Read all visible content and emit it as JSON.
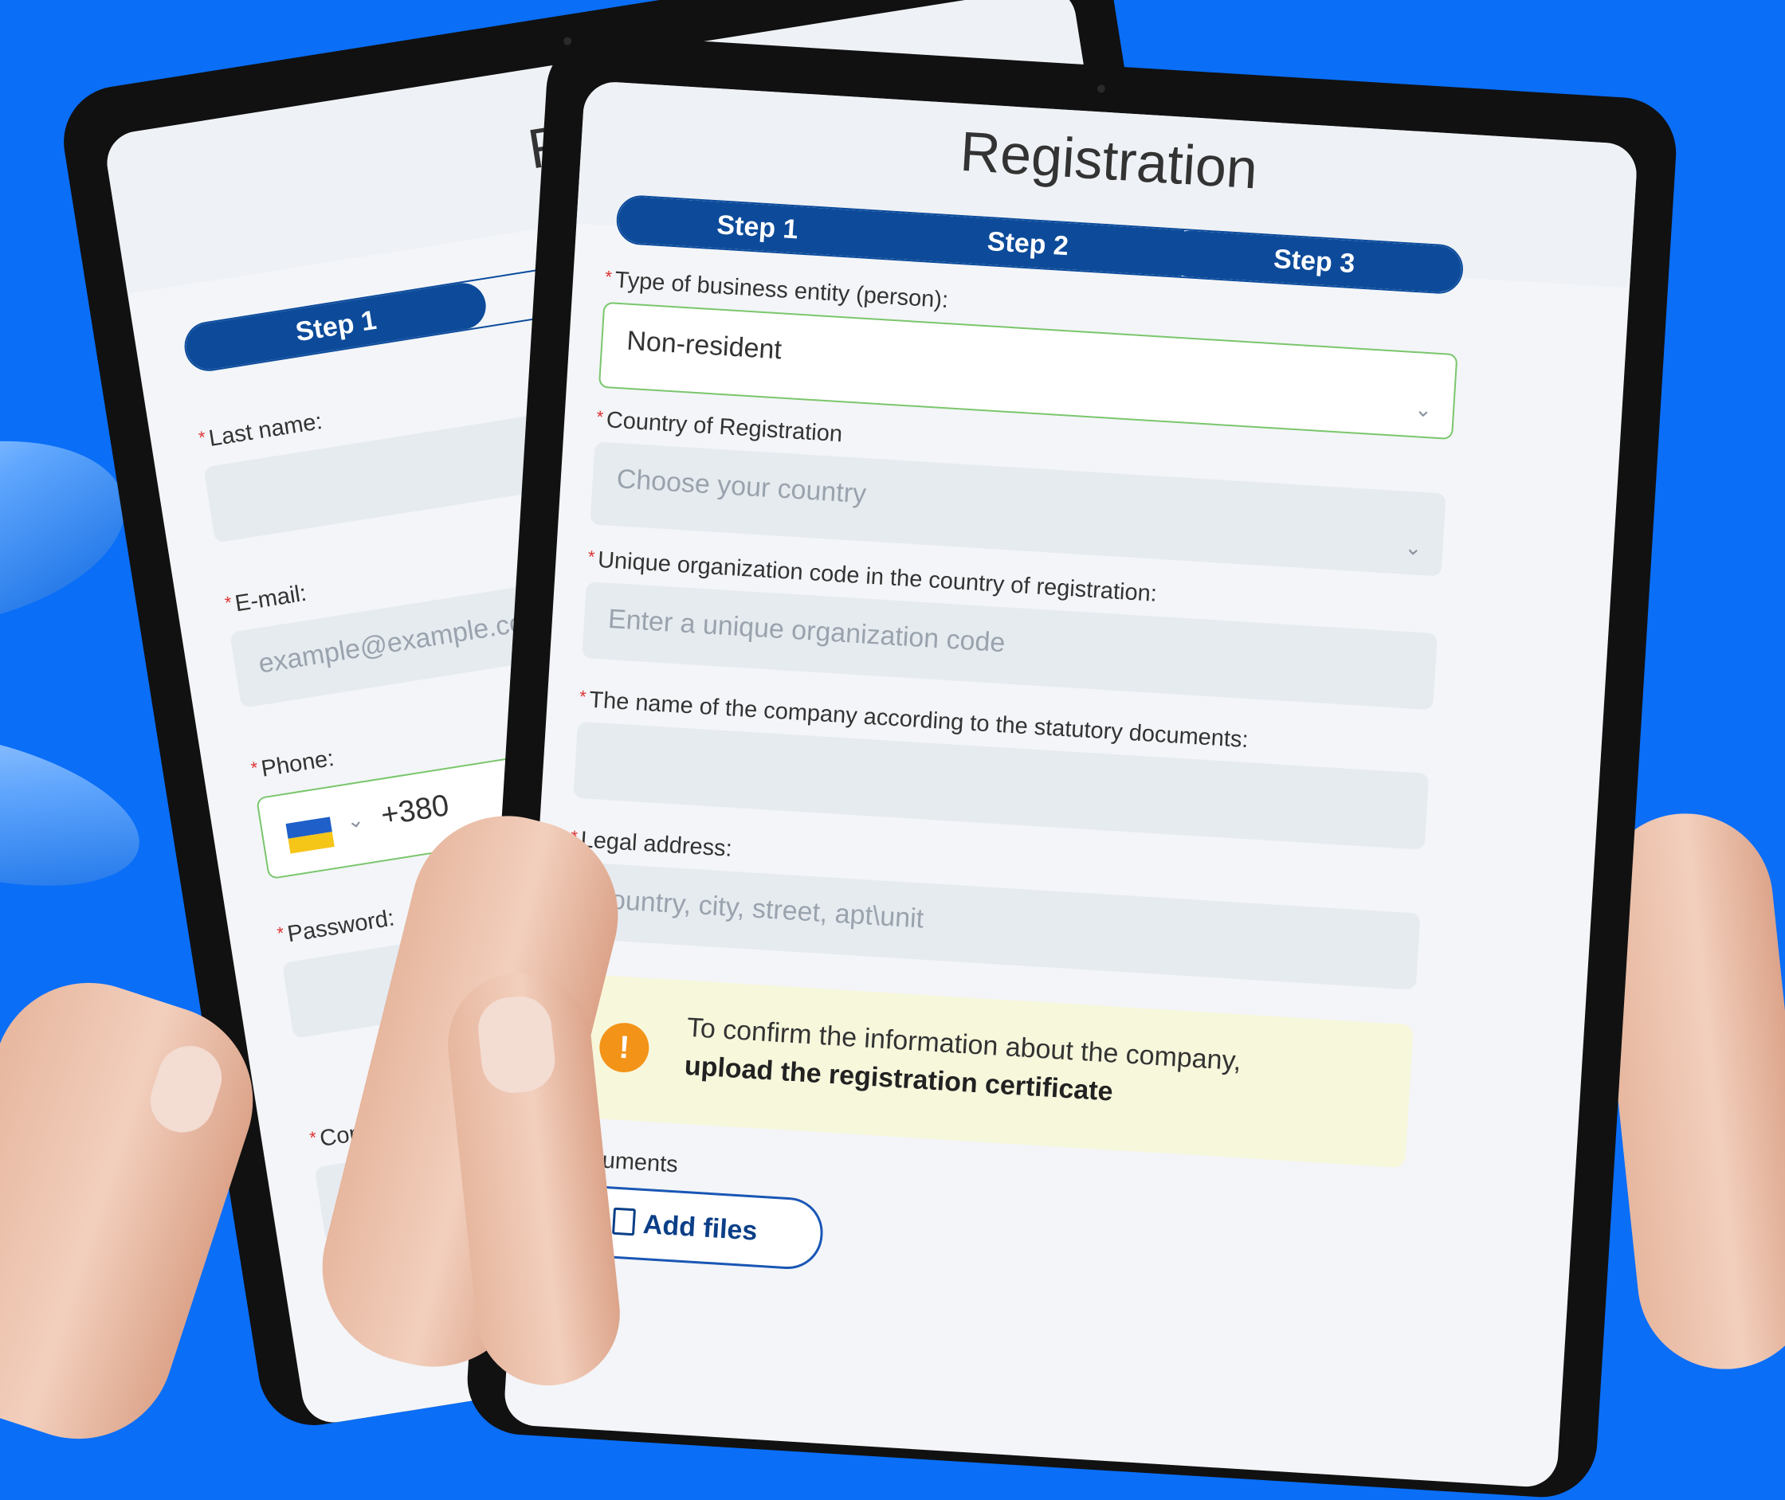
{
  "back_tablet": {
    "title": "Regis",
    "step1": "Step 1",
    "last_name_label": "Last name:",
    "email_label": "E-mail:",
    "email_placeholder": "example@example.com",
    "phone_label": "Phone:",
    "phone_code": "+380",
    "password_label": "Password:",
    "confirm_label": "Con"
  },
  "front_tablet": {
    "title": "Registration",
    "steps": [
      "Step 1",
      "Step 2",
      "Step 3"
    ],
    "active_step": "Step 3",
    "business_type_label": "Type of business entity (person):",
    "business_type_value": "Non-resident",
    "country_label": "Country of Registration",
    "country_placeholder": "Choose your country",
    "org_code_label": "Unique organization code in the country of registration:",
    "org_code_placeholder": "Enter a unique organization code",
    "company_name_label": "The name of the company according to the statutory documents:",
    "address_label": "Legal address:",
    "address_placeholder": "Country, city, street, apt\\unit",
    "alert_line1": "To confirm the information about the company,",
    "alert_line2": "upload the registration certificate",
    "alert_icon": "!",
    "documents_label": "Documents",
    "add_files_label": "Add files"
  },
  "colors": {
    "background": "#0a6ef7",
    "step_active": "#0d4b9a",
    "valid_border": "#7ac66c",
    "alert_bg": "#f7f7dc",
    "alert_icon": "#f39318"
  },
  "icons": [
    "chevron-down-icon",
    "ukraine-flag-icon",
    "exclamation-icon",
    "document-icon"
  ]
}
